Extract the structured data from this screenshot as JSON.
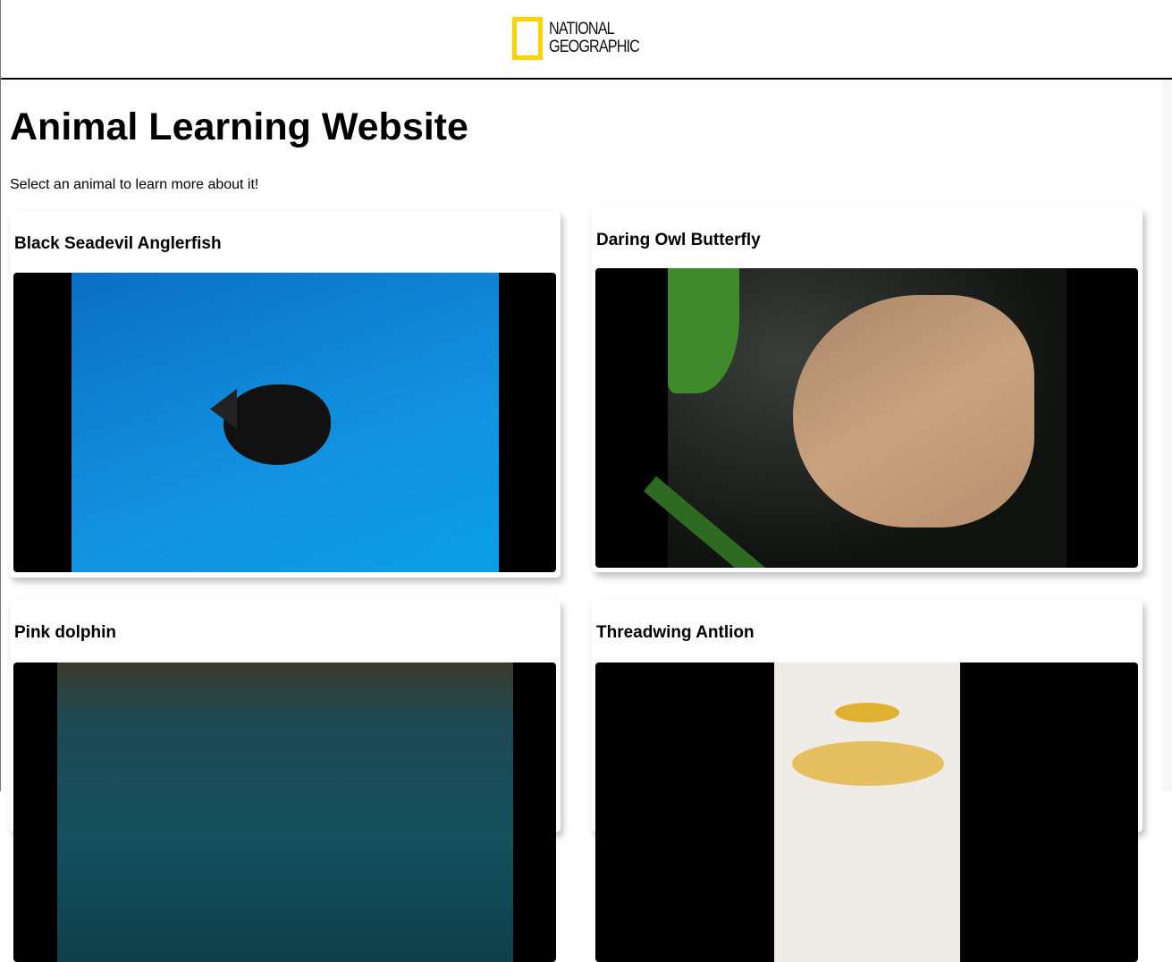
{
  "header": {
    "logo_text_line1": "NATIONAL",
    "logo_text_line2": "GEOGRAPHIC",
    "logo_color": "#ffd200"
  },
  "page": {
    "title": "Animal Learning Website",
    "intro": "Select an animal to learn more about it!"
  },
  "animals": [
    {
      "name": "Black Seadevil Anglerfish",
      "image": "anglerfish-photo"
    },
    {
      "name": "Daring Owl Butterfly",
      "image": "owl-butterfly-photo"
    },
    {
      "name": "Pink dolphin",
      "image": "pink-dolphin-photo"
    },
    {
      "name": "Threadwing Antlion",
      "image": "antlion-illustration"
    }
  ]
}
